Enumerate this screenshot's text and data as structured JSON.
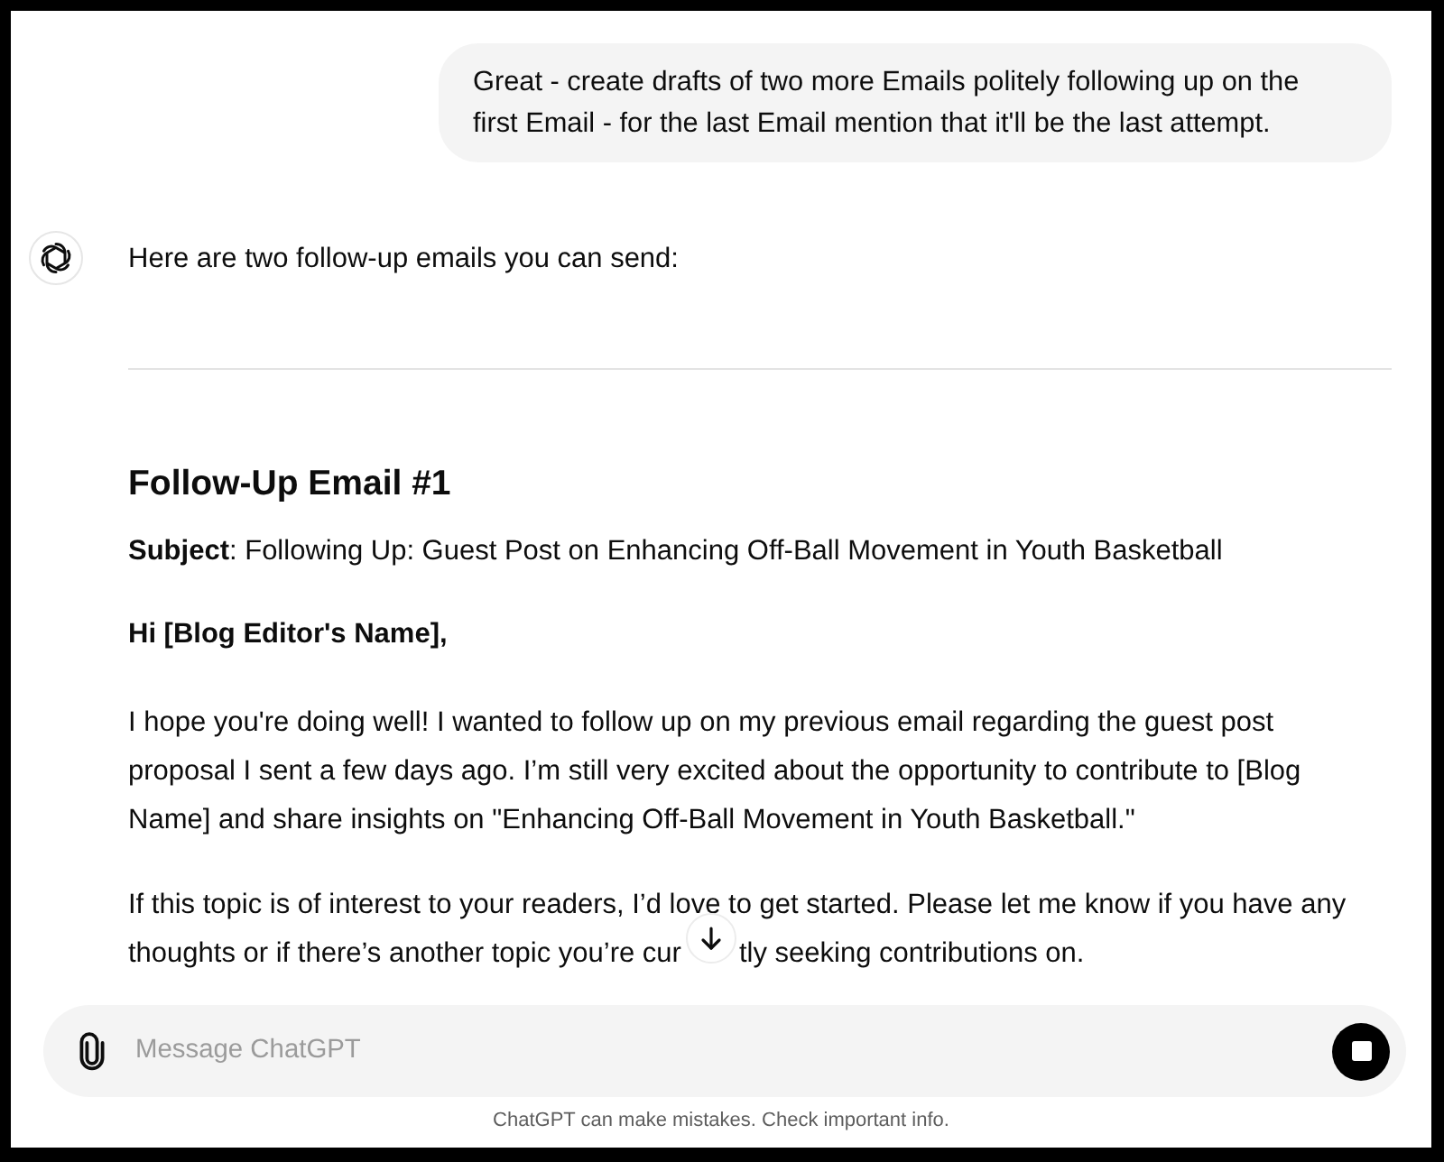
{
  "user_message": {
    "text": "Great - create drafts of two more Emails politely following up on the first Email - for the last Email mention that it'll be the last attempt."
  },
  "assistant_message": {
    "intro": "Here are two follow-up emails you can send:",
    "emails": [
      {
        "heading": "Follow-Up Email #1",
        "subject": "**Subject**: Following Up: Guest Post on Enhancing Off-Ball Movement in Youth Basketball",
        "greeting": "Hi [Blog Editor's Name],",
        "paragraphs": [
          {
            "text": "I hope you're doing well! I wanted to follow up on my previous email regarding the guest post proposal I sent a few days ago. I’m still very excited about the opportunity to contribute to [Blog Name] and share insights on \"Enhancing Off-Ball Movement in Youth Basketball.\""
          },
          {
            "lines": [
              [
                "If this topic is of interest to your readers, I’d love to get started. Please let me know if you have any"
              ],
              [
                "thoughts or if there’s another topic you’re cur",
                "tly seeking contributions on."
              ]
            ]
          }
        ]
      }
    ]
  },
  "composer": {
    "placeholder": "Message ChatGPT",
    "generating": true
  },
  "footer": "ChatGPT can make mistakes. Check important info."
}
